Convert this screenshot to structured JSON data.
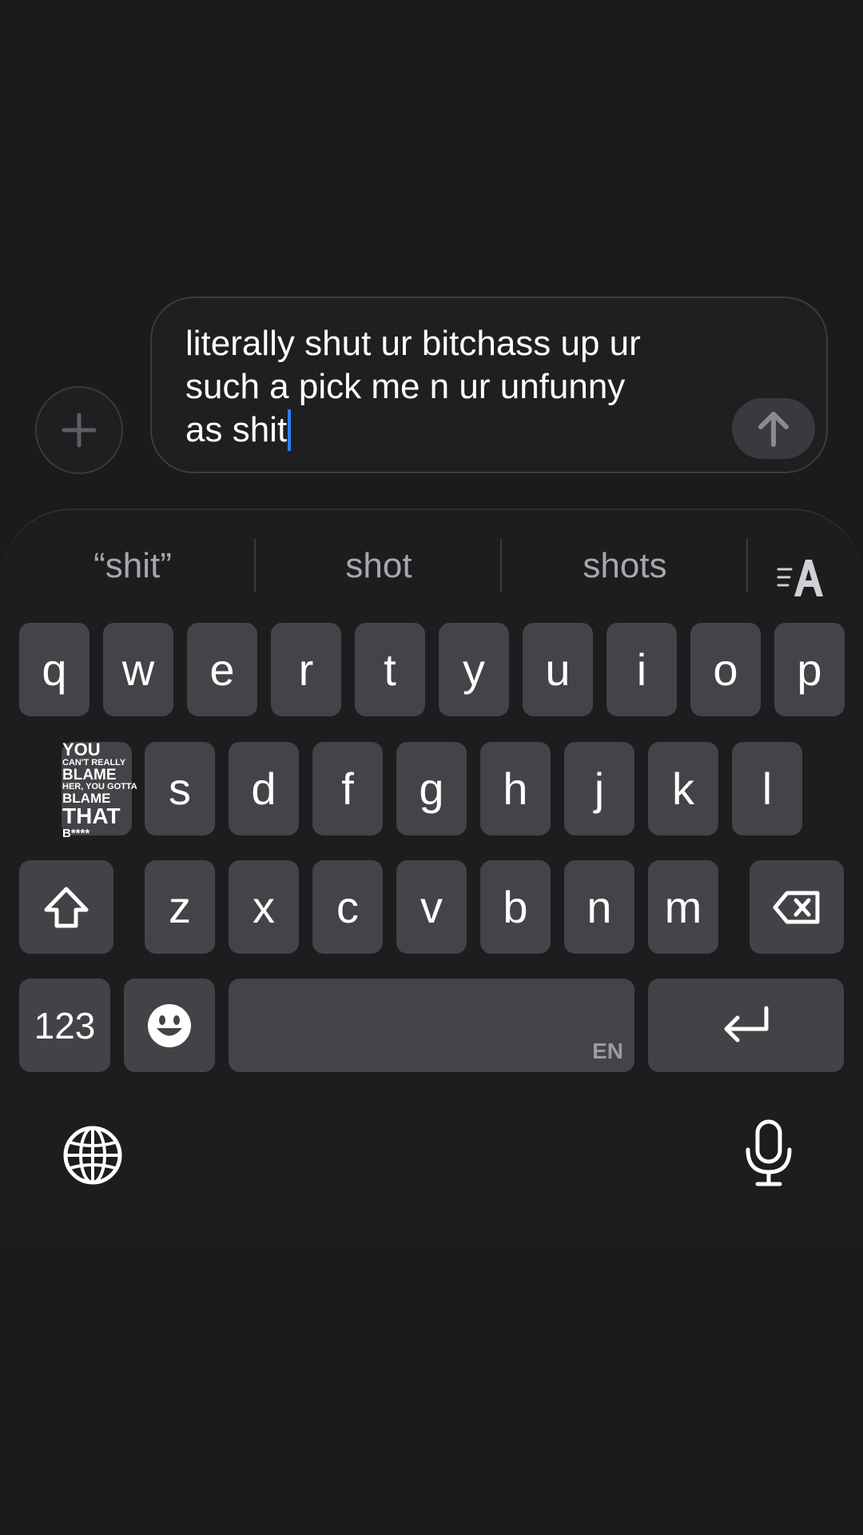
{
  "compose": {
    "text": "literally shut ur bitchass up ur\nsuch a pick me n ur unfunny\nas shit",
    "plus_icon": "plus-icon",
    "send_icon": "arrow-up-icon"
  },
  "suggestions": {
    "items": [
      "“shit”",
      "shot",
      "shots"
    ],
    "format_icon": "text-format-icon"
  },
  "keyboard": {
    "row1": [
      "q",
      "w",
      "e",
      "r",
      "t",
      "y",
      "u",
      "i",
      "o",
      "p"
    ],
    "row2": [
      "s",
      "d",
      "f",
      "g",
      "h",
      "j",
      "k",
      "l"
    ],
    "row3": [
      "z",
      "x",
      "c",
      "v",
      "b",
      "n",
      "m"
    ],
    "numbers_label": "123",
    "space_lang": "EN",
    "shift_icon": "shift-icon",
    "delete_icon": "backspace-icon",
    "emoji_icon": "emoji-icon",
    "return_icon": "return-icon",
    "globe_icon": "globe-icon",
    "mic_icon": "microphone-icon"
  },
  "sticker": {
    "line1": "YOU",
    "line2": "CAN'T REALLY",
    "line3": "BLAME",
    "line4": "HER, YOU GOTTA",
    "line5": "BLAME",
    "line6": "THAT",
    "line7": "B****"
  }
}
